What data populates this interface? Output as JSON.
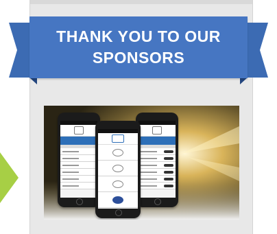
{
  "banner": {
    "title": "THANK YOU TO OUR SPONSORS"
  },
  "colors": {
    "ribbon": "#4676c2",
    "ribbon_tail": "#3c6bb3",
    "ribbon_fold": "#23467f",
    "card": "#e8e8e8",
    "arrow": "#a7cf45"
  },
  "sponsor": {
    "image_description_icon": "phone-app-screenshot-icon"
  }
}
